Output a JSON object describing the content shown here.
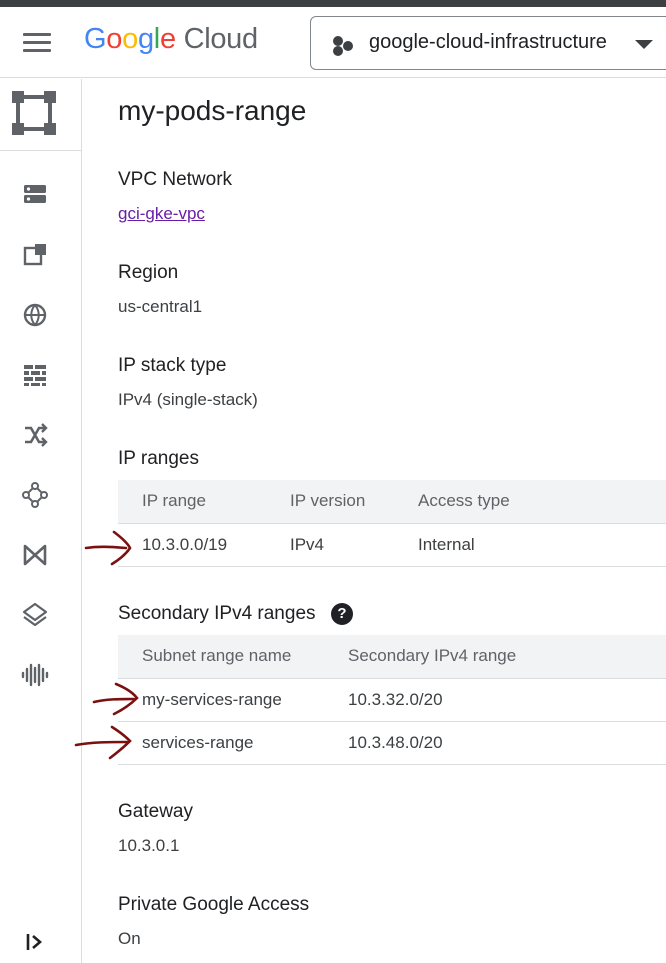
{
  "header": {
    "logo_google": "Google",
    "logo_cloud": "Cloud",
    "project_name": "google-cloud-infrastructure"
  },
  "sidebar": {
    "items": [
      {
        "icon": "server-list-icon"
      },
      {
        "icon": "add-resource-icon"
      },
      {
        "icon": "globe-network-icon"
      },
      {
        "icon": "firewall-icon"
      },
      {
        "icon": "routes-icon"
      },
      {
        "icon": "topology-icon"
      },
      {
        "icon": "peering-icon"
      },
      {
        "icon": "layers-icon"
      },
      {
        "icon": "audio-waveform-icon"
      }
    ]
  },
  "page": {
    "title": "my-pods-range",
    "vpc_network": {
      "label": "VPC Network",
      "value": "gci-gke-vpc"
    },
    "region": {
      "label": "Region",
      "value": "us-central1"
    },
    "ip_stack": {
      "label": "IP stack type",
      "value": "IPv4 (single-stack)"
    },
    "ip_ranges": {
      "label": "IP ranges",
      "columns": [
        "IP range",
        "IP version",
        "Access type"
      ],
      "rows": [
        [
          "10.3.0.0/19",
          "IPv4",
          "Internal"
        ]
      ]
    },
    "secondary": {
      "label": "Secondary IPv4 ranges",
      "help": "?",
      "columns": [
        "Subnet range name",
        "Secondary IPv4 range"
      ],
      "rows": [
        [
          "my-services-range",
          "10.3.32.0/20"
        ],
        [
          "services-range",
          "10.3.48.0/20"
        ]
      ]
    },
    "gateway": {
      "label": "Gateway",
      "value": "10.3.0.1"
    },
    "private_access": {
      "label": "Private Google Access",
      "value": "On"
    }
  },
  "colors": {
    "link": "#681da8",
    "annotation_arrow": "#7a1010",
    "table_header_bg": "#f1f3f4"
  }
}
